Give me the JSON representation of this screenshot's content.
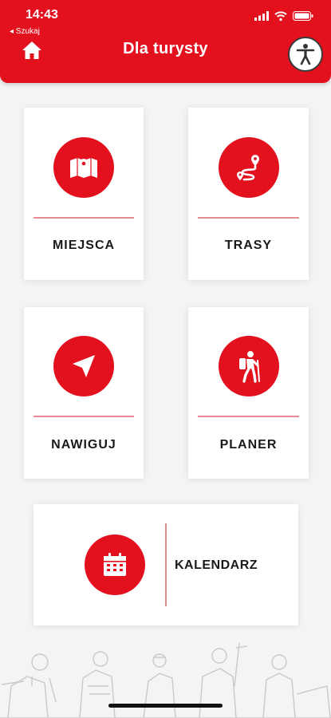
{
  "status_bar": {
    "time": "14:43",
    "back_link": "◂ Szukaj"
  },
  "header": {
    "title": "Dla turysty"
  },
  "tiles": [
    {
      "label": "MIEJSCA",
      "icon": "map-pin-icon"
    },
    {
      "label": "TRASY",
      "icon": "route-icon"
    },
    {
      "label": "NAWIGUJ",
      "icon": "navigation-arrow-icon"
    },
    {
      "label": "PLANER",
      "icon": "hiker-icon"
    }
  ],
  "calendar": {
    "label": "KALENDARZ",
    "icon": "calendar-icon"
  },
  "colors": {
    "accent": "#e3101e",
    "divider": "#e88b91",
    "background": "#f4f4f4"
  }
}
